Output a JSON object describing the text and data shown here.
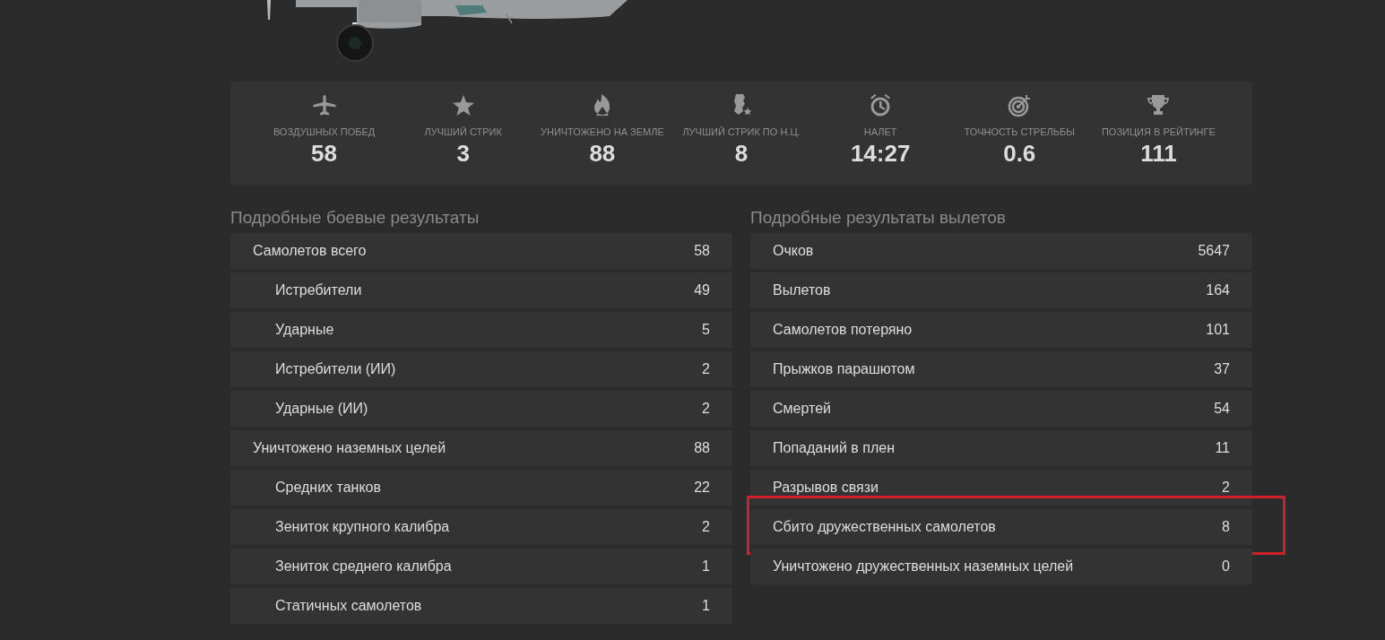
{
  "stats": [
    {
      "label": "ВОЗДУШНЫХ ПОБЕД",
      "value": "58"
    },
    {
      "label": "ЛУЧШИЙ СТРИК",
      "value": "3"
    },
    {
      "label": "УНИЧТОЖЕНО НА ЗЕМЛЕ",
      "value": "88"
    },
    {
      "label": "ЛУЧШИЙ СТРИК ПО Н.Ц.",
      "value": "8"
    },
    {
      "label": "НАЛЕТ",
      "value": "14:27"
    },
    {
      "label": "ТОЧНОСТЬ СТРЕЛЬБЫ",
      "value": "0.6"
    },
    {
      "label": "ПОЗИЦИЯ В РЕЙТИНГЕ",
      "value": "111"
    }
  ],
  "combat_results": {
    "title": "Подробные боевые результаты",
    "rows": [
      {
        "label": "Самолетов всего",
        "value": "58",
        "children": [
          {
            "label": "Истребители",
            "value": "49"
          },
          {
            "label": "Ударные",
            "value": "5"
          },
          {
            "label": "Истребители (ИИ)",
            "value": "2"
          },
          {
            "label": "Ударные (ИИ)",
            "value": "2"
          }
        ]
      },
      {
        "label": "Уничтожено наземных целей",
        "value": "88",
        "children": [
          {
            "label": "Средних танков",
            "value": "22"
          },
          {
            "label": "Зениток крупного калибра",
            "value": "2"
          },
          {
            "label": "Зениток среднего калибра",
            "value": "1"
          },
          {
            "label": "Статичных самолетов",
            "value": "1"
          }
        ]
      }
    ]
  },
  "sortie_results": {
    "title": "Подробные результаты вылетов",
    "rows": [
      {
        "label": "Очков",
        "value": "5647",
        "highlighted": false
      },
      {
        "label": "Вылетов",
        "value": "164",
        "highlighted": false
      },
      {
        "label": "Самолетов потеряно",
        "value": "101",
        "highlighted": false
      },
      {
        "label": "Прыжков парашютом",
        "value": "37",
        "highlighted": false
      },
      {
        "label": "Смертей",
        "value": "54",
        "highlighted": false
      },
      {
        "label": "Попаданий в плен",
        "value": "11",
        "highlighted": false
      },
      {
        "label": "Разрывов связи",
        "value": "2",
        "highlighted": false
      },
      {
        "label": "Сбито дружественных самолетов",
        "value": "8",
        "highlighted": true
      },
      {
        "label": "Уничтожено дружественных наземных целей",
        "value": "0",
        "highlighted": false
      }
    ]
  }
}
